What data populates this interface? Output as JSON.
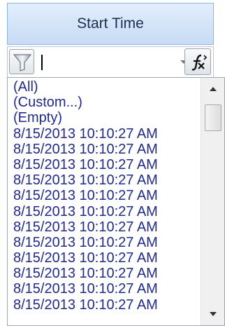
{
  "header": {
    "column_title": "Start Time"
  },
  "filter_row": {
    "filter_icon": "funnel-icon",
    "input_value": "",
    "dropdown_icon": "chevron-down-icon",
    "operator_icon": "function-icon"
  },
  "dropdown": {
    "items": [
      "(All)",
      "(Custom...)",
      "(Empty)",
      "8/15/2013 10:10:27 AM",
      "8/15/2013 10:10:27 AM",
      "8/15/2013 10:10:27 AM",
      "8/15/2013 10:10:27 AM",
      "8/15/2013 10:10:27 AM",
      "8/15/2013 10:10:27 AM",
      "8/15/2013 10:10:27 AM",
      "8/15/2013 10:10:27 AM",
      "8/15/2013 10:10:27 AM",
      "8/15/2013 10:10:27 AM",
      "8/15/2013 10:10:27 AM",
      "8/15/2013 10:10:27 AM"
    ]
  },
  "colors": {
    "header_text": "#1b2d4f",
    "item_text": "#1f2a8a",
    "header_border": "#8fb3e0"
  }
}
